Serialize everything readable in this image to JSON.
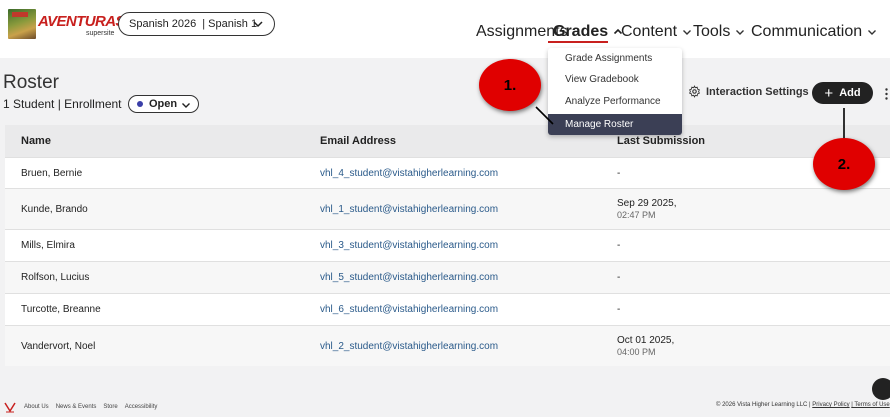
{
  "brand": {
    "title": "AVENTURAS",
    "sub": "supersite"
  },
  "course": {
    "year": "Spanish 2026",
    "separator": "|",
    "name": "Spanish 1"
  },
  "nav": {
    "assignments": "Assignments",
    "grades": "Grades",
    "content": "Content",
    "tools": "Tools",
    "communication": "Communication"
  },
  "grades_menu": {
    "items": [
      "Grade Assignments",
      "View Gradebook",
      "Analyze Performance",
      "Manage Roster"
    ],
    "selected": "Manage Roster"
  },
  "page": {
    "title": "Roster",
    "enrollment": "1 Student | Enrollment",
    "status": "Open",
    "interaction_settings": "Interaction Settings",
    "add": "Add"
  },
  "table": {
    "headers": {
      "name": "Name",
      "email": "Email Address",
      "last_submission": "Last Submission"
    },
    "rows": [
      {
        "name": "Bruen, Bernie",
        "email": "vhl_4_student@vistahigherlearning.com",
        "date": "-",
        "time": ""
      },
      {
        "name": "Kunde, Brando",
        "email": "vhl_1_student@vistahigherlearning.com",
        "date": "Sep 29 2025,",
        "time": "02:47 PM"
      },
      {
        "name": "Mills, Elmira",
        "email": "vhl_3_student@vistahigherlearning.com",
        "date": "-",
        "time": ""
      },
      {
        "name": "Rolfson, Lucius",
        "email": "vhl_5_student@vistahigherlearning.com",
        "date": "-",
        "time": ""
      },
      {
        "name": "Turcotte, Breanne",
        "email": "vhl_6_student@vistahigherlearning.com",
        "date": "-",
        "time": ""
      },
      {
        "name": "Vandervort, Noel",
        "email": "vhl_2_student@vistahigherlearning.com",
        "date": "Oct 01 2025,",
        "time": "04:00 PM"
      }
    ]
  },
  "callouts": {
    "one": "1.",
    "two": "2."
  },
  "footer": {
    "links": [
      "About Us",
      "News & Events",
      "Store",
      "Accessibility"
    ],
    "copyright": "© 2026 Vista Higher Learning LLC |",
    "privacy": "Privacy Policy",
    "terms": "| Terms of Use"
  },
  "colors": {
    "accent": "#c8201e",
    "callout": "#e00000",
    "menu_active": "#3b3f55",
    "link": "#2a5a8a",
    "status_dot": "#3a3fa8"
  },
  "icons": [
    "chevron-down-icon",
    "gear-icon",
    "plus-icon",
    "more-vertical-icon",
    "chat-icon"
  ]
}
